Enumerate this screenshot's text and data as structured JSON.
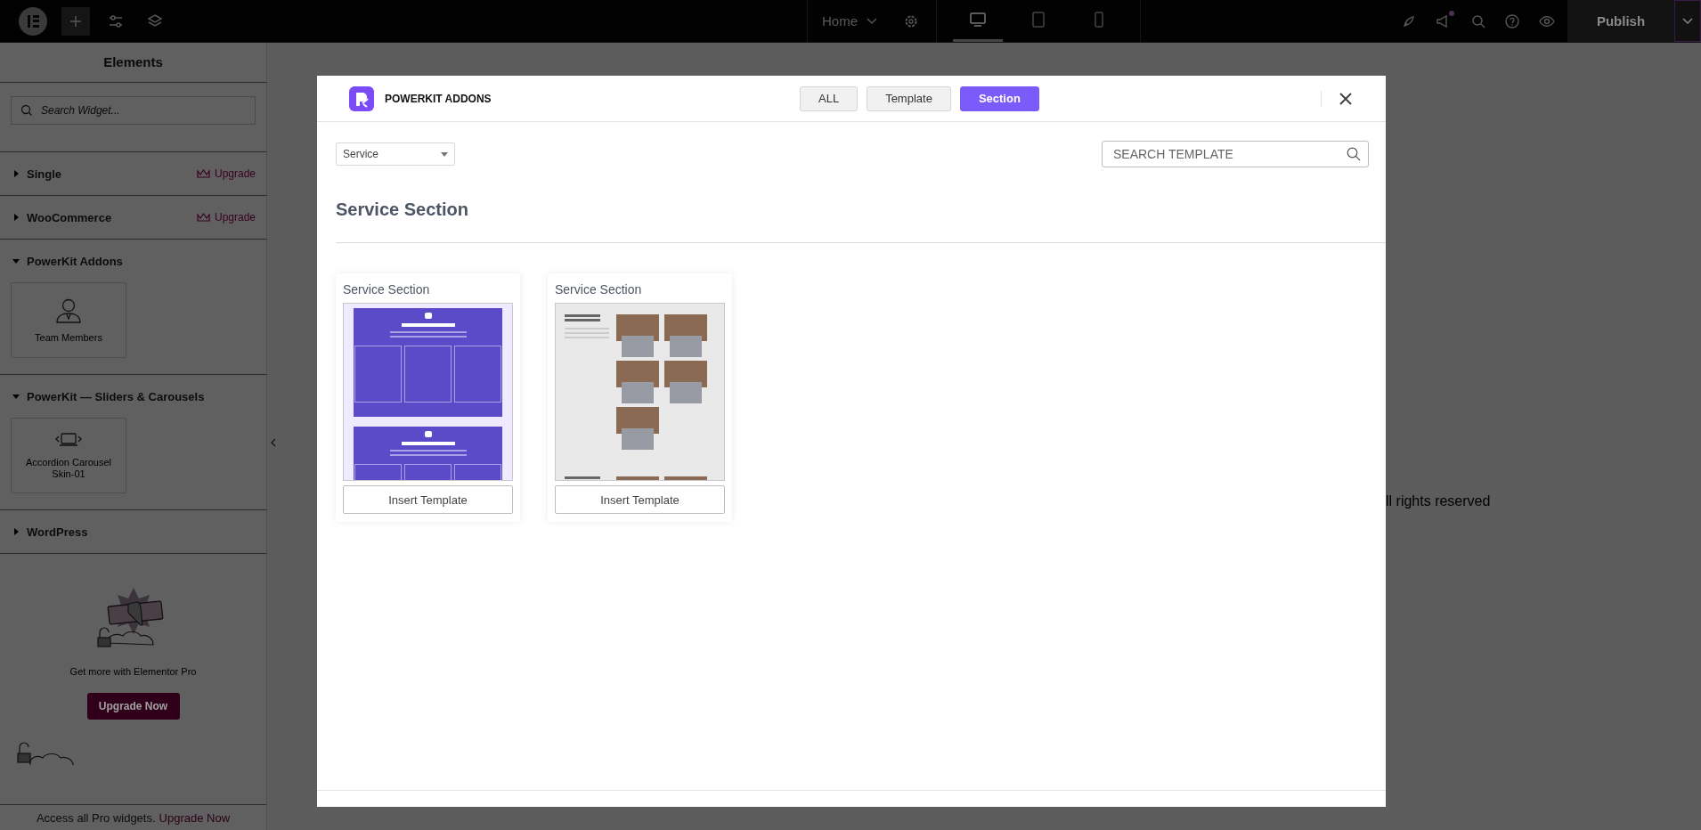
{
  "topbar": {
    "page_menu": "Home",
    "devices": [
      {
        "kind": "desktop",
        "selected": true
      },
      {
        "kind": "tablet",
        "selected": false
      },
      {
        "kind": "mobile",
        "selected": false
      }
    ],
    "notification": true,
    "publish": "Publish"
  },
  "sidebar": {
    "title": "Elements",
    "search_placeholder": "Search Widget...",
    "categories": [
      {
        "name": "Single",
        "expanded": false,
        "badge": "Upgrade"
      },
      {
        "name": "WooCommerce",
        "expanded": false,
        "badge": "Upgrade"
      },
      {
        "name": "PowerKit Addons",
        "expanded": true,
        "widgets": [
          {
            "kind": "person",
            "label": "Team Members"
          }
        ]
      },
      {
        "name": "PowerKit — Sliders & Carousels",
        "expanded": true,
        "widgets": [
          {
            "kind": "laptop",
            "label": "Accordion Carousel Skin-01"
          }
        ]
      },
      {
        "name": "WordPress",
        "expanded": false
      }
    ],
    "promo": {
      "text": "Get more with Elementor Pro",
      "button": "Upgrade Now"
    },
    "footer": {
      "text": "Access all Pro widgets.",
      "link": "Upgrade Now"
    }
  },
  "canvas": {
    "footer_text": "ll rights reserved"
  },
  "modal": {
    "brand": "POWERKIT ADDONS",
    "tabs": [
      {
        "label": "ALL",
        "selected": false
      },
      {
        "label": "Template",
        "selected": false
      },
      {
        "label": "Section",
        "selected": true
      }
    ],
    "filter": {
      "value": "Service"
    },
    "search": {
      "placeholder": "SEARCH TEMPLATE"
    },
    "section_title": "Service Section",
    "templates": [
      {
        "title": "Service Section",
        "kind": "columns",
        "button": "Insert Template"
      },
      {
        "title": "Service Section",
        "kind": "photos",
        "button": "Insert Template"
      }
    ]
  }
}
